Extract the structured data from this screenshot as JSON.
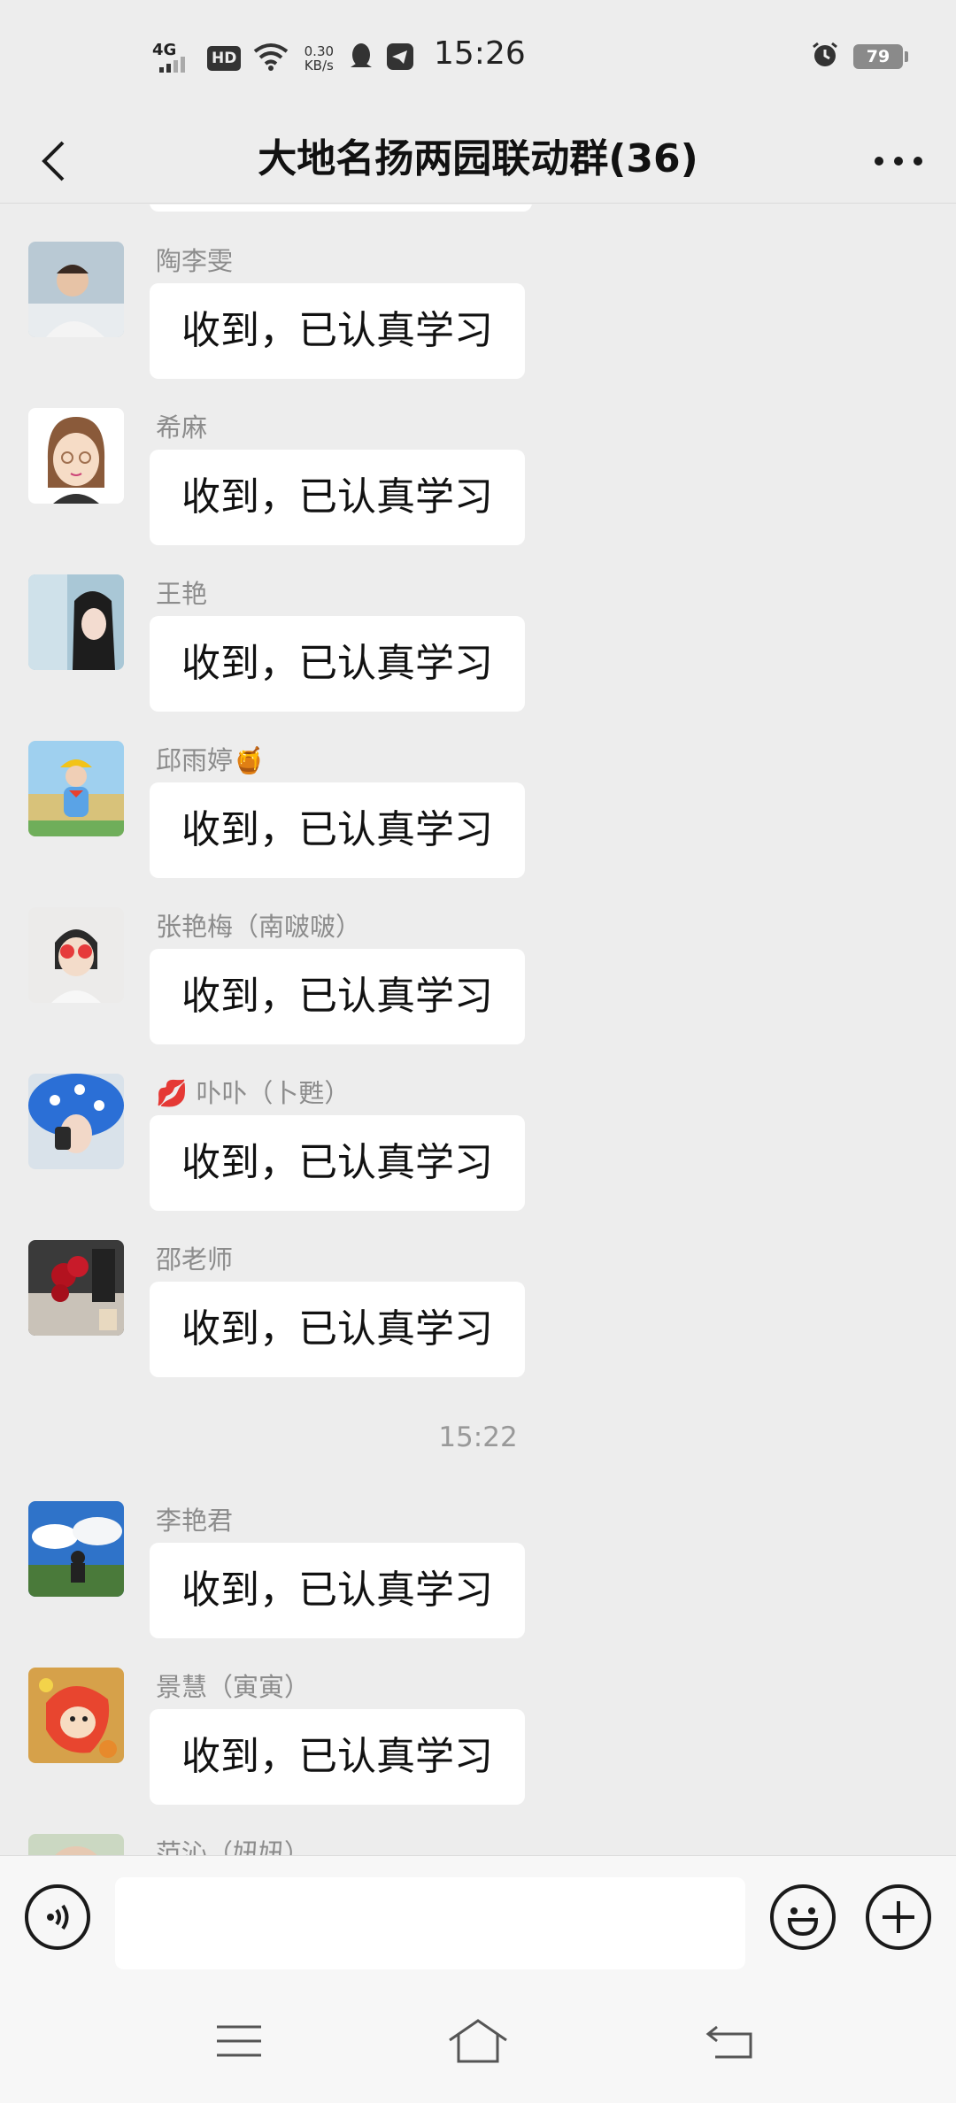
{
  "status_bar": {
    "network": "4G",
    "hd": "HD",
    "speed_value": "0.30",
    "speed_unit": "KB/s",
    "time": "15:26",
    "battery": "79"
  },
  "header": {
    "title": "大地名扬两园联动群(36)"
  },
  "messages": [
    {
      "sender": "陶李雯",
      "text": "收到，已认真学习"
    },
    {
      "sender": "希麻",
      "text": "收到，已认真学习"
    },
    {
      "sender": "王艳",
      "text": "收到，已认真学习"
    },
    {
      "sender": "邱雨婷🍯",
      "text": "收到，已认真学习"
    },
    {
      "sender": "张艳梅（南啵啵）",
      "text": "收到，已认真学习"
    },
    {
      "sender": "💋 卟卟（卜甦）",
      "text": "收到，已认真学习"
    },
    {
      "sender": "邵老师",
      "text": "收到，已认真学习"
    },
    {
      "sender": "李艳君",
      "text": "收到，已认真学习"
    },
    {
      "sender": "景慧（寅寅）",
      "text": "收到，已认真学习"
    },
    {
      "sender": "范沁（妞妞）",
      "text": ""
    }
  ],
  "timestamp": "15:22",
  "colors": {
    "background": "#ededed",
    "bubble": "#ffffff",
    "sender_name": "#8c8c8c",
    "input_bar": "#f7f7f7"
  }
}
